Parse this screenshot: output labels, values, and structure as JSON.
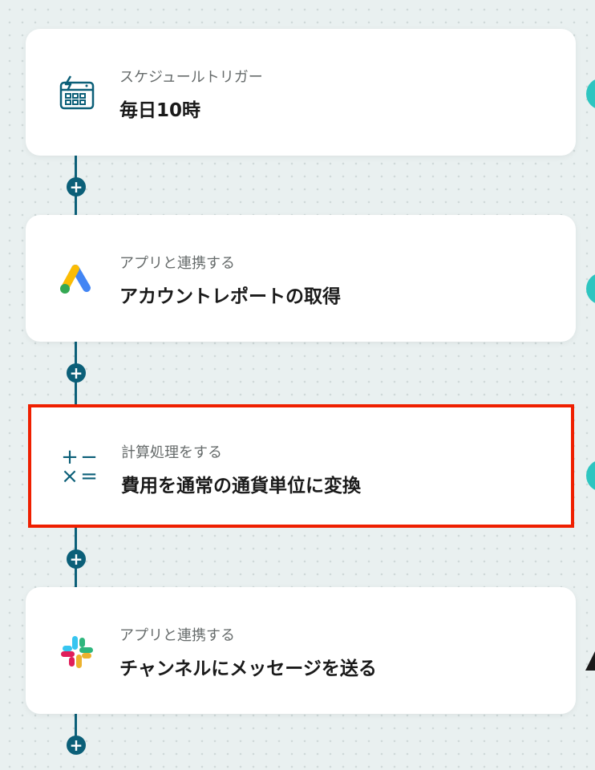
{
  "steps": [
    {
      "subtitle": "スケジュールトリガー",
      "title": "毎日10時",
      "icon": "calendar-schedule-icon"
    },
    {
      "subtitle": "アプリと連携する",
      "title": "アカウントレポートの取得",
      "icon": "google-ads-icon"
    },
    {
      "subtitle": "計算処理をする",
      "title": "費用を通常の通貨単位に変換",
      "icon": "calculator-ops-icon",
      "ops": {
        "plus": "+",
        "minus": "−",
        "times": "×",
        "equals": "="
      }
    },
    {
      "subtitle": "アプリと連携する",
      "title": "チャンネルにメッセージを送る",
      "icon": "slack-icon"
    }
  ],
  "add_label": "+",
  "colors": {
    "connector": "#0b5f78",
    "selection": "#ef1f00",
    "side_accent": "#2ec5c0"
  }
}
